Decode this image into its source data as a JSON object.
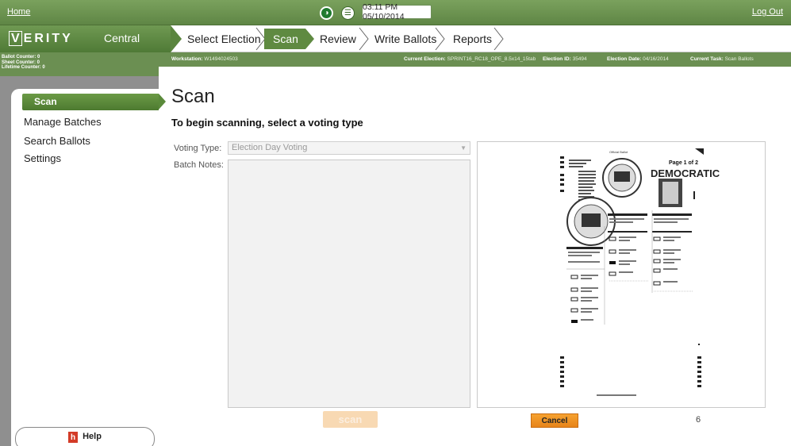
{
  "topbar": {
    "home": "Home",
    "logout": "Log Out",
    "clock": "03:11 PM 05/10/2014"
  },
  "brand": {
    "logo_v": "V",
    "logo_rest": "ERITY",
    "product": "Central"
  },
  "tabs": [
    {
      "label": "Select Election"
    },
    {
      "label": "Scan"
    },
    {
      "label": "Review"
    },
    {
      "label": "Write Ballots"
    },
    {
      "label": "Reports"
    }
  ],
  "counters": {
    "ballot": "Ballot Counter: 0",
    "sheet": "Sheet Counter: 0",
    "lifetime": "Lifetime Counter: 0"
  },
  "info": {
    "workstation_label": "Workstation:",
    "workstation_value": "W1494024503",
    "current_election_label": "Current Election:",
    "current_election_value": "SPRINT16_RC18_OPE_8.5x14_15tab",
    "election_id_label": "Election ID:",
    "election_id_value": "35494",
    "election_date_label": "Election Date:",
    "election_date_value": "04/16/2014",
    "current_task_label": "Current Task:",
    "current_task_value": "Scan Ballots"
  },
  "sidebar": {
    "items": [
      {
        "label": "Scan",
        "active": true
      },
      {
        "label": "Manage Batches"
      },
      {
        "label": "Search Ballots"
      },
      {
        "label": "Settings"
      }
    ],
    "help": "Help",
    "help_icon": "h"
  },
  "main": {
    "title": "Scan",
    "subtitle": "To begin scanning, select a voting type",
    "voting_type_label": "Voting Type:",
    "voting_type_value": "Election Day Voting",
    "batch_notes_label": "Batch Notes:",
    "scan_button": "scan"
  },
  "preview": {
    "official_ballot": "Official Ballot",
    "page_label": "Page 1 of 2",
    "party_banner": "DEMOCRATIC",
    "cancel_button": "Cancel",
    "page_count": "6"
  },
  "colors": {
    "accent_green": "#5f8a41",
    "topbar_green": "#6b8f52",
    "cancel_orange": "#f09425"
  }
}
